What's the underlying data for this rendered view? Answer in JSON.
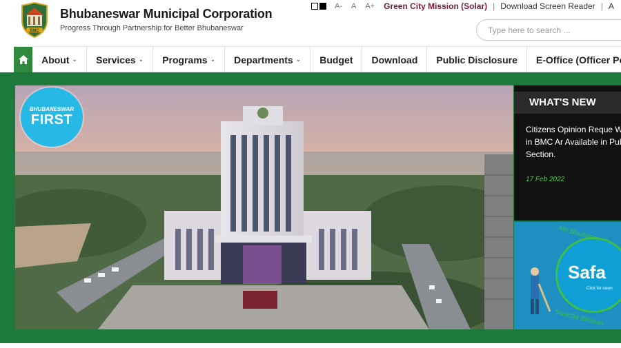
{
  "header": {
    "title": "Bhubaneswar Municipal Corporation",
    "tagline": "Progress Through Partnership for Better Bhubaneswar",
    "logo_text": "BMC"
  },
  "topbar": {
    "font_decrease": "A-",
    "font_normal": "A",
    "font_increase": "A+",
    "green_city": "Green City Mission (Solar)",
    "screen_reader": "Download Screen Reader",
    "more": "A"
  },
  "search": {
    "placeholder": "Type here to search ..."
  },
  "nav": {
    "items": [
      {
        "label": "About"
      },
      {
        "label": "Services"
      },
      {
        "label": "Programs"
      },
      {
        "label": "Departments"
      },
      {
        "label": "Budget"
      },
      {
        "label": "Download"
      },
      {
        "label": "Public Disclosure"
      },
      {
        "label": "E-Office (Officer Po"
      }
    ]
  },
  "banner": {
    "badge_small": "BHUBANESWAR",
    "badge_big": "FIRST"
  },
  "news": {
    "heading": "WHAT'S NEW",
    "item_text": "Citizens Opinion Reque Waterbodies in BMC Ar Available in Public Discl Section.",
    "item_date": "17 Feb 2022"
  },
  "safai": {
    "arc_top": "Mo Bhubanes",
    "title": "Safa",
    "subtitle": "Click for clean",
    "arc_bottom": "Swacha Bhuban"
  },
  "colors": {
    "brand_green": "#1e7a3c",
    "nav_home_green": "#2f8a3e",
    "link_maroon": "#7a1a3a",
    "news_date_green": "#5cc85c",
    "badge_blue": "#28b8e6"
  }
}
